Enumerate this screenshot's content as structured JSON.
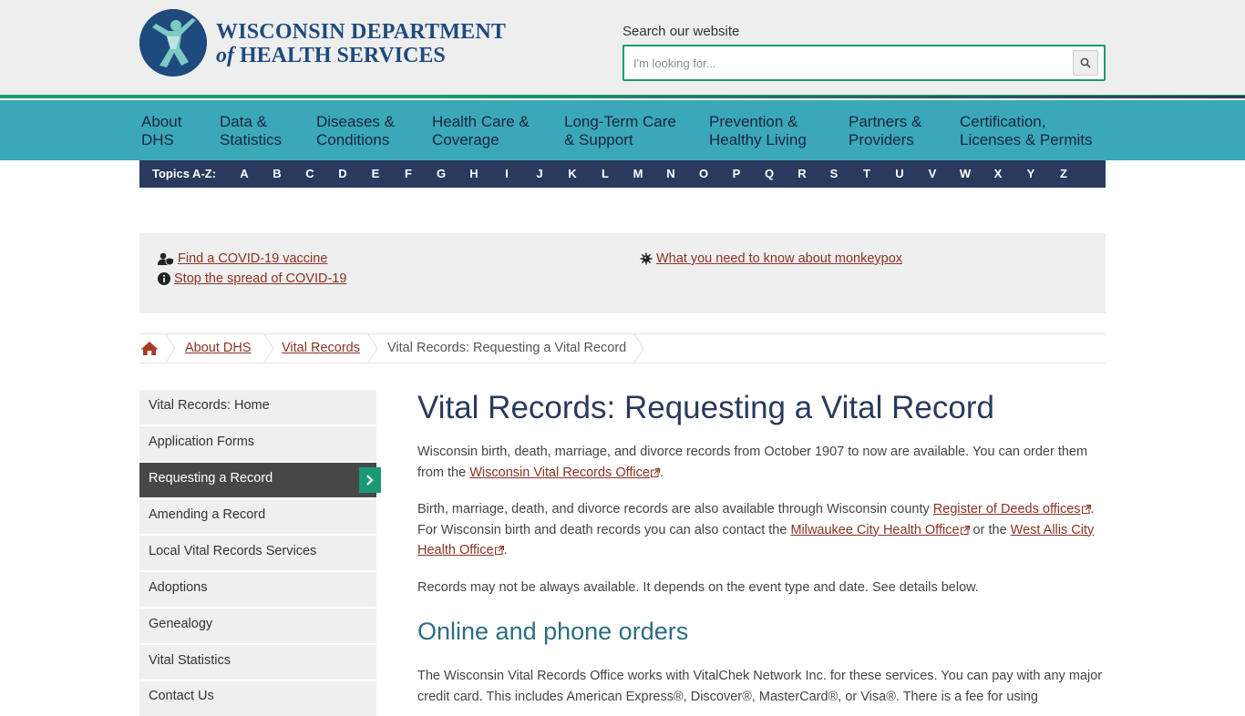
{
  "header": {
    "logo_line1": "WISCONSIN DEPARTMENT",
    "logo_of": "of",
    "logo_line2": "HEALTH SERVICES",
    "search_label": "Search our website",
    "search_placeholder": "I'm looking for..."
  },
  "nav": [
    {
      "line1": "About",
      "line2": "DHS"
    },
    {
      "line1": "Data &",
      "line2": "Statistics"
    },
    {
      "line1": "Diseases &",
      "line2": "Conditions"
    },
    {
      "line1": "Health Care &",
      "line2": "Coverage"
    },
    {
      "line1": "Long-Term Care",
      "line2": "& Support"
    },
    {
      "line1": "Prevention &",
      "line2": "Healthy Living"
    },
    {
      "line1": "Partners &",
      "line2": "Providers"
    },
    {
      "line1": "Certification,",
      "line2": "Licenses & Permits"
    }
  ],
  "topics": {
    "label": "Topics A-Z:",
    "letters": [
      "A",
      "B",
      "C",
      "D",
      "E",
      "F",
      "G",
      "H",
      "I",
      "J",
      "K",
      "L",
      "M",
      "N",
      "O",
      "P",
      "Q",
      "R",
      "S",
      "T",
      "U",
      "V",
      "W",
      "X",
      "Y",
      "Z"
    ]
  },
  "alerts": [
    {
      "text": "Find a COVID-19 vaccine",
      "icon": "person-shield-icon"
    },
    {
      "text": "Stop the spread of COVID-19",
      "icon": "info-circle-icon"
    },
    {
      "text": "What you need to know about monkeypox",
      "icon": "virus-icon"
    }
  ],
  "breadcrumb": {
    "items": [
      "About DHS",
      "Vital Records"
    ],
    "current": "Vital Records: Requesting a Vital Record"
  },
  "sidebar": {
    "items": [
      "Vital Records: Home",
      "Application Forms",
      "Requesting a Record",
      "Amending a Record",
      "Local Vital Records Services",
      "Adoptions",
      "Genealogy",
      "Vital Statistics",
      "Contact Us"
    ],
    "active": "Requesting a Record"
  },
  "main": {
    "title": "Vital Records: Requesting a Vital Record",
    "p1_text": "Wisconsin birth, death, marriage, and divorce records from October 1907 to now are available. You can order them from the ",
    "p1_link": "Wisconsin Vital Records Office",
    "p1_end": ".",
    "p2_a": "Birth, marriage, death, and divorce records are also available through Wisconsin county ",
    "p2_link1": "Register of Deeds offices",
    "p2_b": ". For Wisconsin birth and death records you can also contact the ",
    "p2_link2": "Milwaukee City Health Office",
    "p2_c": " or the ",
    "p2_link3": "West Allis City Health Office",
    "p2_end": ".",
    "p3": "Records may not be always available. It depends on the event type and date. See details below.",
    "h2": "Online and phone orders",
    "p4": "The Wisconsin Vital Records Office works with VitalChek Network Inc. for these services. You can pay with any major credit card. This includes American Express®, Discover®, MasterCard®, or Visa®. There is a fee for using"
  }
}
